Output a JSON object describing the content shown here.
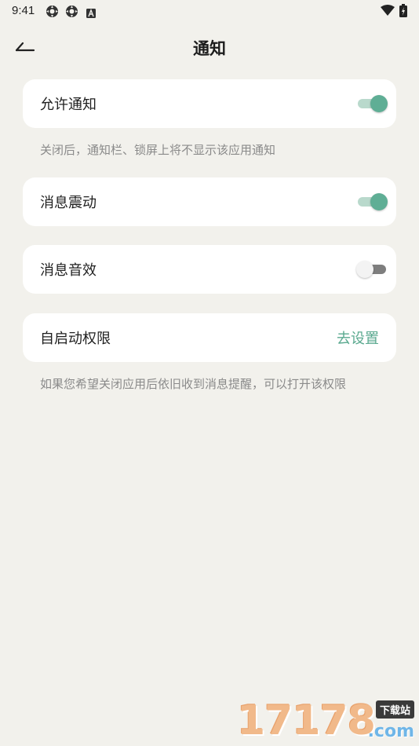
{
  "status_bar": {
    "time": "9:41",
    "left_icons": [
      "settings-gear-icon",
      "settings-gear-icon",
      "app-a-icon"
    ],
    "right_icons": [
      "wifi-icon",
      "battery-icon"
    ]
  },
  "header": {
    "back_icon": "back-arrow-icon",
    "title": "通知"
  },
  "settings": {
    "allow_notifications": {
      "label": "允许通知",
      "enabled": true
    },
    "allow_notifications_hint": "关闭后，通知栏、锁屏上将不显示该应用通知",
    "message_vibration": {
      "label": "消息震动",
      "enabled": true
    },
    "message_sound": {
      "label": "消息音效",
      "enabled": false
    },
    "auto_start": {
      "label": "自启动权限",
      "action_label": "去设置"
    },
    "auto_start_hint": "如果您希望关闭应用后依旧收到消息提醒，可以打开该权限"
  },
  "watermark": {
    "digits": "17178",
    "badge": "下载站",
    "suffix": ".com"
  },
  "colors": {
    "background": "#f2f1ec",
    "card": "#ffffff",
    "accent": "#5fae95",
    "accent_text": "#5aa98f",
    "hint_text": "#8a8a8a"
  }
}
